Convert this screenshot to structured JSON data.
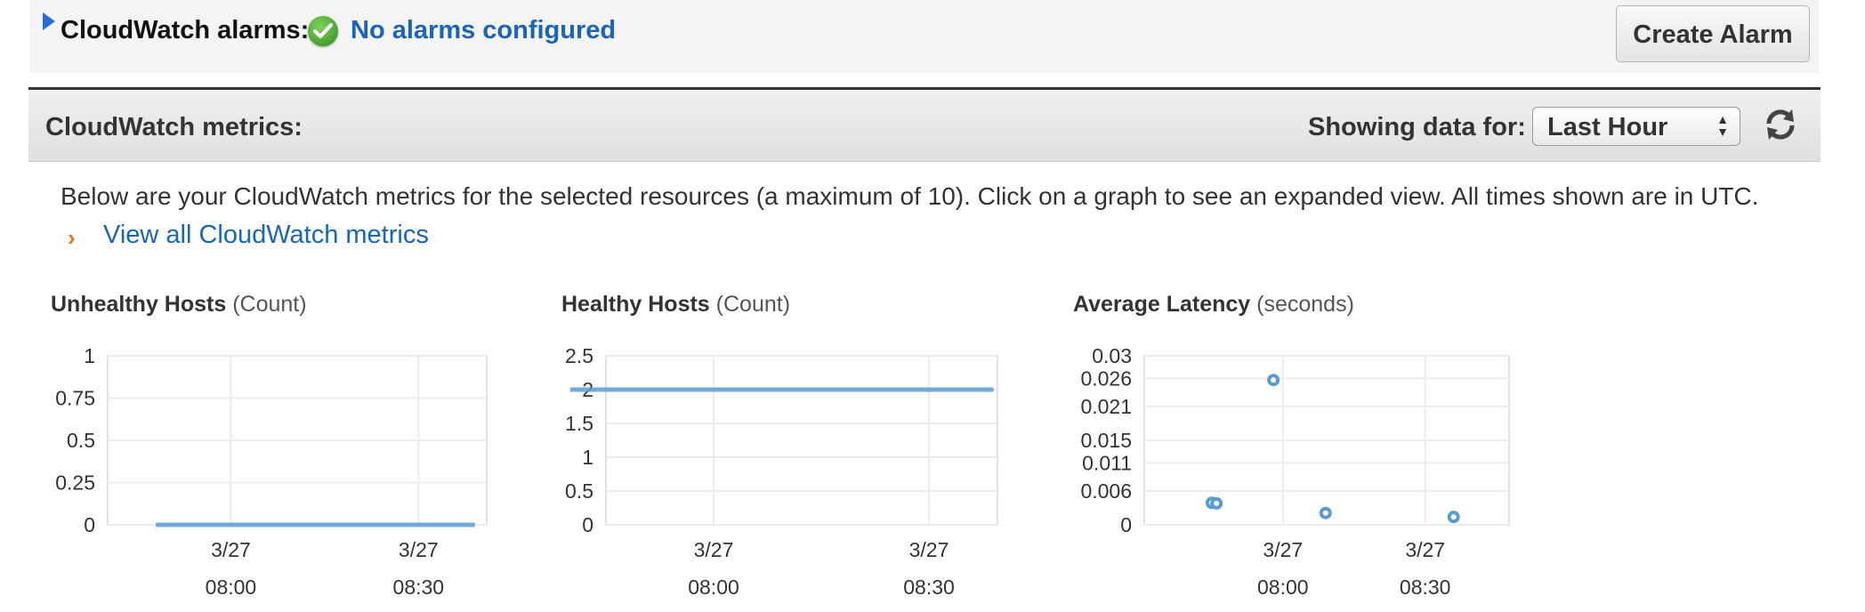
{
  "alarms": {
    "title": "CloudWatch alarms:",
    "status": "No alarms configured",
    "create_button": "Create Alarm",
    "status_icon": "check-circle-icon",
    "status_color": "#1a64b9"
  },
  "metrics": {
    "title": "CloudWatch metrics:",
    "showing_label": "Showing data for:",
    "period_selected": "Last Hour",
    "description": "Below are your CloudWatch metrics for the selected resources (a maximum of 10). Click on a graph to see an expanded view. All times shown are in UTC.",
    "view_all_link": "View all CloudWatch metrics"
  },
  "chart_data": [
    {
      "type": "line",
      "title": "Unhealthy Hosts",
      "unit": "(Count)",
      "yticks": [
        "0",
        "0.25",
        "0.5",
        "0.75",
        "1"
      ],
      "ylim": [
        0,
        1
      ],
      "xticks": [
        {
          "date": "3/27",
          "time": "08:00"
        },
        {
          "date": "3/27",
          "time": "08:30"
        }
      ],
      "x": [
        "07:48",
        "08:39"
      ],
      "series": [
        {
          "values": [
            0,
            0
          ]
        }
      ],
      "grid": true,
      "color": "#5a9bd5"
    },
    {
      "type": "line",
      "title": "Healthy Hosts",
      "unit": "(Count)",
      "yticks": [
        "0",
        "0.5",
        "1",
        "1.5",
        "2",
        "2.5"
      ],
      "ylim": [
        0,
        2.5
      ],
      "xticks": [
        {
          "date": "3/27",
          "time": "08:00"
        },
        {
          "date": "3/27",
          "time": "08:30"
        }
      ],
      "x": [
        "07:40",
        "08:39"
      ],
      "series": [
        {
          "values": [
            2,
            2
          ]
        }
      ],
      "grid": true,
      "color": "#5a9bd5"
    },
    {
      "type": "scatter",
      "title": "Average Latency",
      "unit": "(seconds)",
      "yticks": [
        "0",
        "0.006",
        "0.011",
        "0.015",
        "0.021",
        "0.026",
        "0.03"
      ],
      "ylim": [
        0,
        0.03
      ],
      "xticks": [
        {
          "date": "3/27",
          "time": "08:00"
        },
        {
          "date": "3/27",
          "time": "08:30"
        }
      ],
      "x": [
        "07:45",
        "07:46",
        "07:58",
        "08:09",
        "08:36"
      ],
      "series": [
        {
          "values": [
            0.0039,
            0.0038,
            0.0257,
            0.0021,
            0.0014
          ]
        }
      ],
      "grid": true,
      "color": "#5a9bd5"
    }
  ]
}
